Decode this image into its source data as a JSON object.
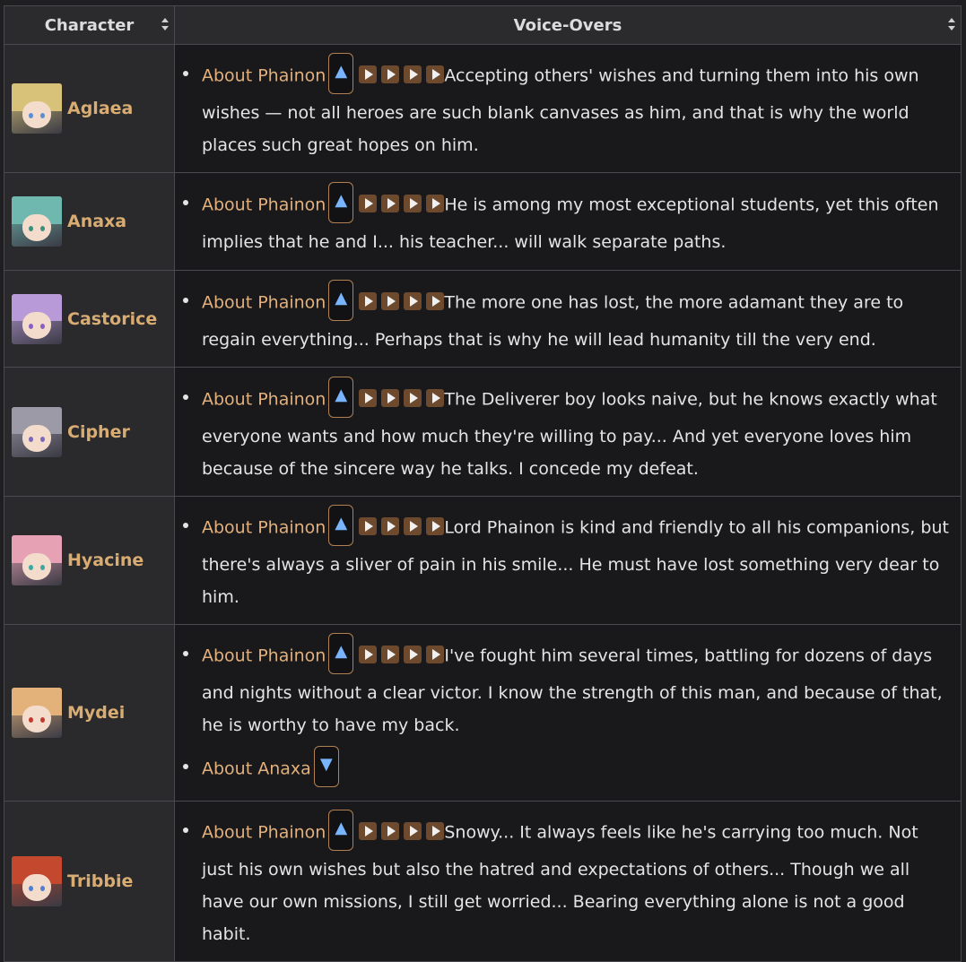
{
  "table": {
    "headers": {
      "character": "Character",
      "voice_overs": "Voice-Overs"
    },
    "rows": [
      {
        "name": "Aglaea",
        "avatar": {
          "hair": "#d8c27a",
          "eye": "#5b8fd4"
        },
        "lines": [
          {
            "topic": "About Phainon",
            "toggle": "▲",
            "text": "Accepting others' wishes and turning them into his own wishes — not all heroes are such blank canvases as him, and that is why the world places such great hopes on him."
          }
        ]
      },
      {
        "name": "Anaxa",
        "avatar": {
          "hair": "#6fb8b0",
          "eye": "#3d8f7d"
        },
        "lines": [
          {
            "topic": "About Phainon",
            "toggle": "▲",
            "text": "He is among my most exceptional students, yet this often implies that he and I... his teacher... will walk separate paths."
          }
        ]
      },
      {
        "name": "Castorice",
        "avatar": {
          "hair": "#b89ad8",
          "eye": "#8a5fc4"
        },
        "lines": [
          {
            "topic": "About Phainon",
            "toggle": "▲",
            "text": "The more one has lost, the more adamant they are to regain everything... Perhaps that is why he will lead humanity till the very end."
          }
        ]
      },
      {
        "name": "Cipher",
        "avatar": {
          "hair": "#9d9aa8",
          "eye": "#7b68b8"
        },
        "lines": [
          {
            "topic": "About Phainon",
            "toggle": "▲",
            "text": "The Deliverer boy looks naive, but he knows exactly what everyone wants and how much they're willing to pay... And yet everyone loves him because of the sincere way he talks. I concede my defeat."
          }
        ]
      },
      {
        "name": "Hyacine",
        "avatar": {
          "hair": "#e7a1b4",
          "eye": "#3fa7a3"
        },
        "lines": [
          {
            "topic": "About Phainon",
            "toggle": "▲",
            "text": "Lord Phainon is kind and friendly to all his companions, but there's always a sliver of pain in his smile... He must have lost something very dear to him."
          }
        ]
      },
      {
        "name": "Mydei",
        "avatar": {
          "hair": "#e2b27a",
          "eye": "#c23a2e"
        },
        "lines": [
          {
            "topic": "About Phainon",
            "toggle": "▲",
            "text": "I've fought him several times, battling for dozens of days and nights without a clear victor. I know the strength of this man, and because of that, he is worthy to have my back."
          },
          {
            "topic": "About Anaxa",
            "toggle": "▼",
            "text": ""
          }
        ]
      },
      {
        "name": "Tribbie",
        "avatar": {
          "hair": "#c4482e",
          "eye": "#4f7fd0"
        },
        "lines": [
          {
            "topic": "About Phainon",
            "toggle": "▲",
            "text": "Snowy... It always feels like he's carrying too much. Not just his own wishes but also the hatred and expectations of others... Though we all have our own missions, I still get worried... Bearing everything alone is not a good habit."
          }
        ]
      }
    ]
  }
}
